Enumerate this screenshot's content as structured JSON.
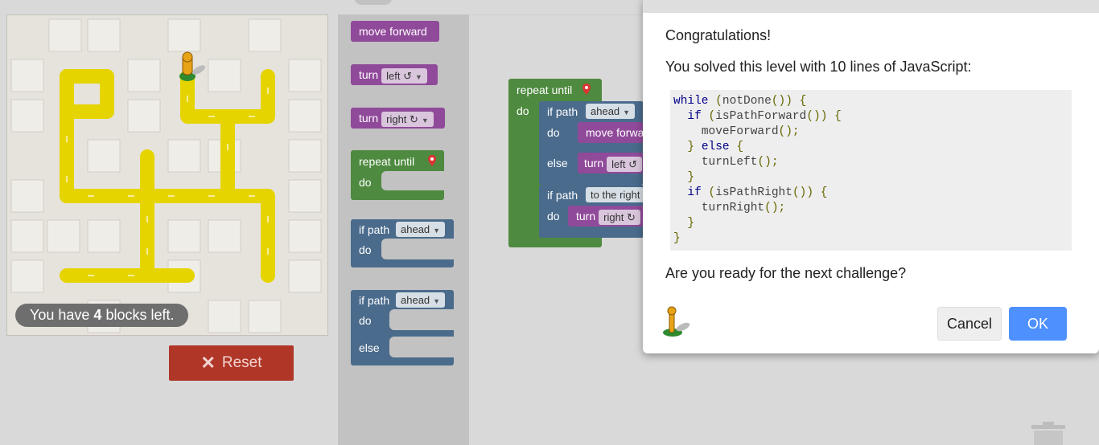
{
  "maze": {
    "blocks_left_prefix": "You have ",
    "blocks_left_count": "4",
    "blocks_left_suffix": " blocks left.",
    "path_color": "#e6d400",
    "player_color": "#e8a317"
  },
  "reset": {
    "icon": "close-icon",
    "label": "Reset",
    "color": "#b03628"
  },
  "toolbox": {
    "move_forward": "move forward",
    "turn_label": "turn",
    "left_option": "left ↺",
    "right_option": "right ↻",
    "repeat_until": "repeat until",
    "do_label": "do",
    "else_label": "else",
    "if_path": "if path",
    "ahead_option": "ahead"
  },
  "workspace": {
    "repeat_until": "repeat until",
    "do_label": "do",
    "if_path": "if path",
    "ahead_option": "ahead",
    "move_forward": "move forwa",
    "else_label": "else",
    "turn_label": "turn",
    "left_option": "left ↺",
    "if_path_2": "if path",
    "to_the_right_option": "to the right",
    "right_option": "right ↻"
  },
  "dialog": {
    "congrats": "Congratulations!",
    "solved_text": "You solved this level with 10 lines of JavaScript:",
    "code_lines": [
      "while (notDone()) {",
      "  if (isPathForward()) {",
      "    moveForward();",
      "  } else {",
      "    turnLeft();",
      "  }",
      "  if (isPathRight()) {",
      "    turnRight();",
      "  }",
      "}"
    ],
    "question": "Are you ready for the next challenge?",
    "cancel_label": "Cancel",
    "ok_label": "OK",
    "ok_color": "#4d90fe"
  }
}
